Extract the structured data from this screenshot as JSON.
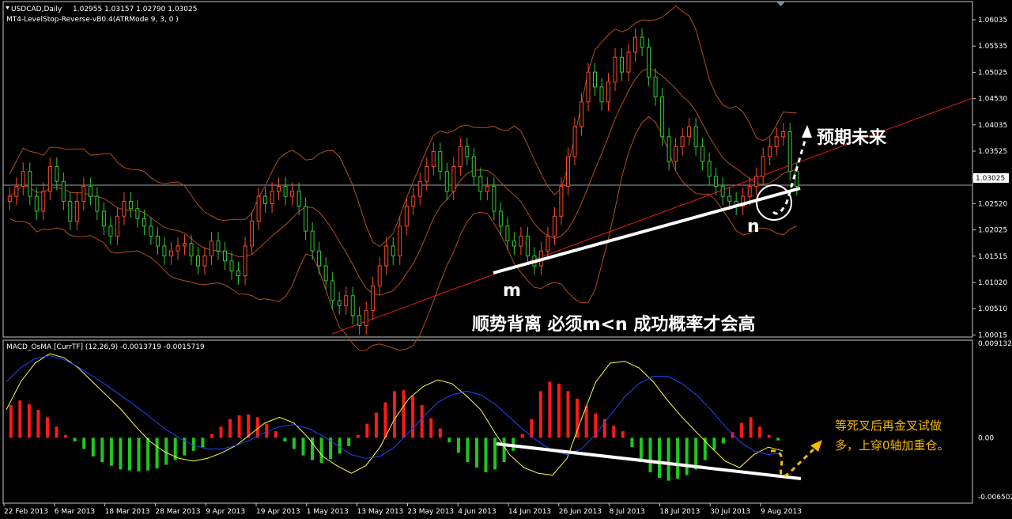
{
  "header": {
    "title": "USDCAD,Daily",
    "ohlc": "1.02955 1.03157 1.02790 1.03025",
    "indicator": "MT4-LevelStop-Reverse-vB0.4(ATRMode 9, 3, 0 )",
    "macd_title": "MACD_OsMA [CurrTF] (12,26,9) -0.0013719 -0.0015719"
  },
  "colors": {
    "bull": "#ff4a26",
    "bear": "#32c832",
    "boll": "#b34d1a",
    "trend": "#e81a1a",
    "macd_pos": "#ff1a1a",
    "macd_neg": "#1ec81e",
    "macd_line": "#ffff46",
    "signal_line": "#2244ff",
    "annot_white": "#ffffff",
    "annot_yellow": "#f5b800"
  },
  "price_axis": {
    "ticks": [
      "1.06035",
      "1.05535",
      "1.05025",
      "1.04530",
      "1.04035",
      "1.03525",
      "1.03025",
      "1.02520",
      "1.02025",
      "1.01515",
      "1.01020",
      "1.00510",
      "1.00015"
    ],
    "current": "1.03025"
  },
  "macd_axis": {
    "ticks": [
      "0.0091329",
      "0.00",
      "-0.006502"
    ]
  },
  "date_axis": {
    "ticks": [
      "22 Feb 2013",
      "6 Mar 2013",
      "18 Mar 2013",
      "28 Mar 2013",
      "9 Apr 2013",
      "19 Apr 2013",
      "1 May 2013",
      "13 May 2013",
      "23 May 2013",
      "4 Jun 2013",
      "14 Jun 2013",
      "26 Jun 2013",
      "8 Jul 2013",
      "18 Jul 2013",
      "30 Jul 2013",
      "9 Aug 2013"
    ]
  },
  "annotations": {
    "m": "m",
    "n": "n",
    "future": "预期未来",
    "divergence": "顺势背离 必须m<n 成功概率才会高",
    "note_line1": "等死叉后再金叉试做",
    "note_line2": "多，上穿0轴加重仓。"
  },
  "chart_data": [
    {
      "type": "candlestick",
      "title": "USDCAD,Daily",
      "ylim": [
        1.0,
        1.064
      ],
      "close": [
        1.028,
        1.03,
        1.033,
        1.028,
        1.025,
        1.029,
        1.034,
        1.031,
        1.027,
        1.023,
        1.027,
        1.03,
        1.028,
        1.025,
        1.022,
        1.02,
        1.024,
        1.027,
        1.0255,
        1.0235,
        1.022,
        1.02,
        1.018,
        1.016,
        1.017,
        1.018,
        1.0185,
        1.016,
        1.014,
        1.016,
        1.019,
        1.017,
        1.015,
        1.013,
        1.012,
        1.018,
        1.023,
        1.028,
        1.0265,
        1.029,
        1.03,
        1.028,
        1.029,
        1.026,
        1.021,
        1.017,
        1.014,
        1.011,
        1.007,
        1.006,
        1.008,
        1.004,
        1.002,
        1.005,
        1.01,
        1.014,
        1.018,
        1.016,
        1.022,
        1.026,
        1.028,
        1.031,
        1.034,
        1.037,
        1.033,
        1.029,
        1.034,
        1.038,
        1.036,
        1.032,
        1.029,
        1.03,
        1.025,
        1.022,
        1.019,
        1.018,
        1.02,
        1.016,
        1.014,
        1.017,
        1.02,
        1.024,
        1.03,
        1.036,
        1.042,
        1.047,
        1.053,
        1.05,
        1.047,
        1.051,
        1.056,
        1.053,
        1.057,
        1.06,
        1.058,
        1.052,
        1.048,
        1.04,
        1.035,
        1.038,
        1.04,
        1.042,
        1.038,
        1.035,
        1.032,
        1.03,
        1.028,
        1.027,
        1.026,
        1.028,
        1.03,
        1.032,
        1.036,
        1.038,
        1.04,
        1.041,
        1.033,
        1.03
      ]
    },
    {
      "type": "bar",
      "title": "MACD_OsMA [CurrTF] (12,26,9)",
      "ylim": [
        -0.0065,
        0.0091
      ],
      "values": [
        0.0035,
        0.004,
        0.0036,
        0.003,
        0.0022,
        0.0012,
        0.0003,
        -0.0004,
        -0.0012,
        -0.002,
        -0.0026,
        -0.003,
        -0.0034,
        -0.0035,
        -0.0036,
        -0.0035,
        -0.0033,
        -0.0029,
        -0.0024,
        -0.0019,
        -0.0014,
        -0.001,
        0.0004,
        0.0012,
        0.002,
        0.0024,
        0.0025,
        0.0022,
        0.0015,
        0.0007,
        -0.0004,
        -0.0012,
        -0.0019,
        -0.0024,
        -0.0027,
        -0.0023,
        -0.0017,
        -0.0009,
        0.0003,
        0.0015,
        0.0027,
        0.0038,
        0.005,
        0.0051,
        0.0045,
        0.0035,
        0.0021,
        0.001,
        -0.0005,
        -0.0016,
        -0.0026,
        -0.0032,
        -0.0037,
        -0.0034,
        -0.0026,
        -0.0014,
        0.0004,
        0.002,
        0.005,
        0.006,
        0.0058,
        0.005,
        0.0042,
        0.0034,
        0.0026,
        0.002,
        0.0013,
        0.0007,
        -0.001,
        -0.0025,
        -0.0037,
        -0.0043,
        -0.0046,
        -0.0044,
        -0.004,
        -0.0034,
        -0.0024,
        -0.0013,
        -0.0006,
        0.0006,
        0.0016,
        0.0022,
        0.0012,
        0.0003,
        -0.0003
      ],
      "macd": [
        0.003,
        0.006,
        0.008,
        0.009,
        0.0086,
        0.0075,
        0.006,
        0.0045,
        0.003,
        0.0012,
        -0.0004,
        -0.0015,
        -0.0022,
        -0.0025,
        -0.0022,
        -0.0016,
        -0.0008,
        0.0004,
        0.0016,
        0.0022,
        0.0016,
        0.0,
        -0.002,
        -0.003,
        -0.0038,
        -0.003,
        -0.001,
        0.002,
        0.0042,
        0.0055,
        0.0062,
        0.0058,
        0.0045,
        0.003,
        0.0005,
        -0.0018,
        -0.0032,
        -0.0038,
        -0.004,
        -0.0022,
        0.002,
        0.006,
        0.008,
        0.0082,
        0.0075,
        0.006,
        0.004,
        0.0022,
        0.0006,
        -0.001,
        -0.0025,
        -0.0032,
        -0.0018,
        -0.001,
        -0.0014
      ],
      "signal": [
        0.006,
        0.0075,
        0.0085,
        0.0088,
        0.0084,
        0.0076,
        0.0066,
        0.0056,
        0.0045,
        0.0034,
        0.0022,
        0.001,
        0.0,
        -0.0008,
        -0.0012,
        -0.0012,
        -0.0008,
        -0.0002,
        0.0006,
        0.0012,
        0.0014,
        0.001,
        0.0002,
        -0.0008,
        -0.0018,
        -0.0022,
        -0.002,
        -0.001,
        0.0006,
        0.0022,
        0.0038,
        0.0046,
        0.005,
        0.0046,
        0.0036,
        0.0022,
        0.0008,
        -0.0004,
        -0.0014,
        -0.0018,
        -0.0012,
        0.0004,
        0.0024,
        0.0044,
        0.0058,
        0.0066,
        0.0066,
        0.0058,
        0.0046,
        0.003,
        0.0012,
        -0.0004,
        -0.0014,
        -0.0018,
        -0.0016
      ]
    }
  ]
}
